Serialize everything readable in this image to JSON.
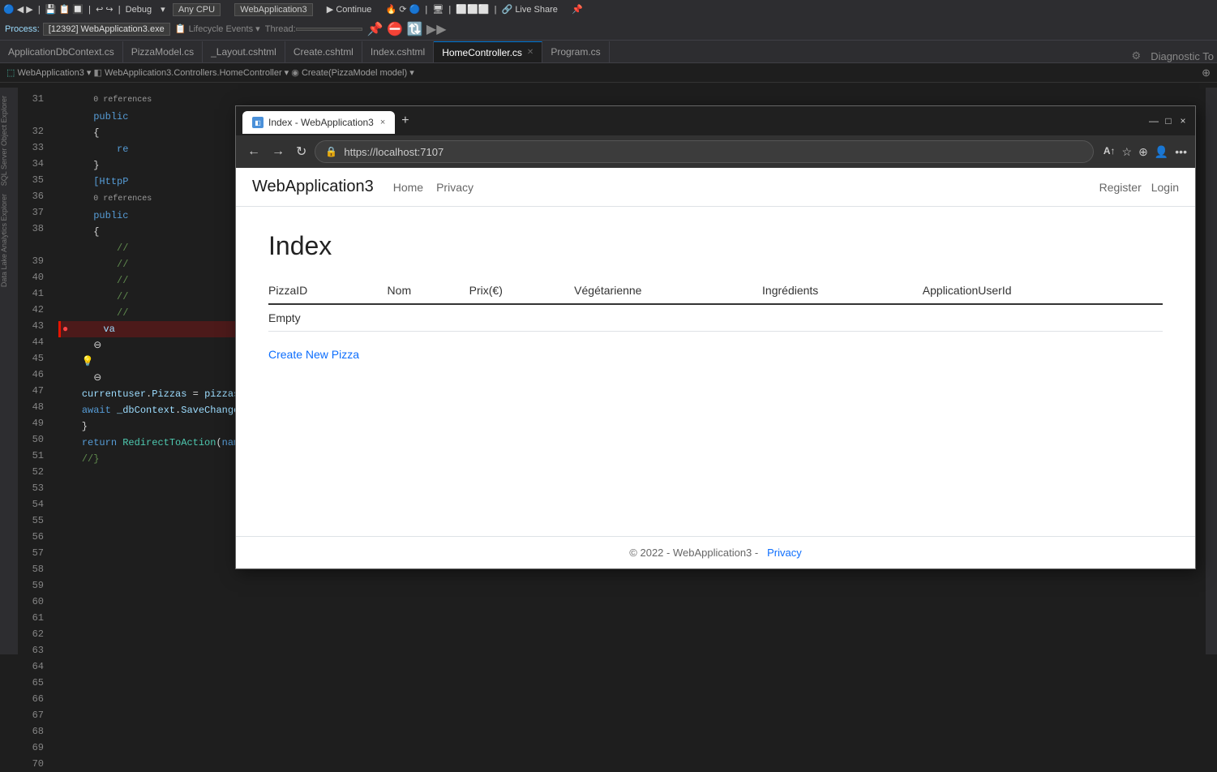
{
  "ide": {
    "top_bar": {
      "items": [
        "CPU"
      ]
    },
    "toolbar": {
      "process_label": "Process:",
      "process_value": "[12392] WebApplication3.exe",
      "debug_label": "Debug",
      "cpu_label": "Any CPU",
      "app_label": "WebApplication3",
      "continue_label": "Continue",
      "live_share_label": "Live Share"
    },
    "lifecycle_events": "Lifecycle Events",
    "thread_label": "Thread:",
    "tabs": [
      {
        "label": "ApplicationDbContext.cs",
        "active": false,
        "close": false
      },
      {
        "label": "PizzaModel.cs",
        "active": false,
        "close": false
      },
      {
        "label": "_Layout.cshtml",
        "active": false,
        "close": false
      },
      {
        "label": "Create.cshtml",
        "active": false,
        "close": false
      },
      {
        "label": "Index.cshtml",
        "active": false,
        "close": false
      },
      {
        "label": "HomeController.cs",
        "active": true,
        "close": true
      },
      {
        "label": "Program.cs",
        "active": false,
        "close": false
      }
    ],
    "breadcrumb": {
      "project": "WebApplication3",
      "class": "WebApplication3.Controllers.HomeController",
      "method": "Create(PizzaModel model)"
    },
    "line_numbers": [
      31,
      32,
      33,
      34,
      35,
      36,
      37,
      38,
      39,
      40,
      41,
      42,
      43,
      44,
      45,
      46,
      47,
      48,
      49,
      50,
      51,
      52,
      53,
      54,
      55,
      56,
      57,
      58,
      59,
      60,
      61,
      62,
      63,
      64,
      65,
      66,
      67,
      68,
      69,
      70
    ],
    "code_lines": [
      "        public",
      "        {",
      "            re",
      "        }",
      "",
      "",
      "        [HttpP",
      "        0 references",
      "        public",
      "",
      "            //",
      "            //",
      "            //",
      "            //",
      "            //",
      "            //",
      "            va",
      "",
      "",
      "        ⚡",
      "",
      "",
      "",
      "",
      "",
      "",
      "",
      "",
      "",
      "",
      "",
      "",
      "",
      "            currentuser.Pizzas = pizzas;",
      "            await _dbContext.SaveChangesAsync();",
      "        }",
      "",
      "        return RedirectToAction(nameof(Index));",
      "        //}",
      ""
    ],
    "sidebar_labels": [
      "SQL Server Object Explorer",
      "Data Lake Analytics Explorer"
    ]
  },
  "browser": {
    "title": "Index - WebApplication3",
    "tab_icon": "◧",
    "close_button": "×",
    "new_tab_button": "+",
    "window_controls": {
      "minimize": "—",
      "maximize": "□",
      "close": "×"
    },
    "nav": {
      "back_disabled": false,
      "forward_disabled": false,
      "refresh": "↻",
      "url": "https://localhost:7107",
      "read_aloud": "A↑",
      "favorites": "☆",
      "star": "⭐",
      "collections": "⊕",
      "profile": "👤",
      "more": "•••"
    },
    "page": {
      "brand": "WebApplication3",
      "nav_links": [
        "Home",
        "Privacy"
      ],
      "auth_links": [
        "Register",
        "Login"
      ],
      "heading": "Index",
      "table": {
        "columns": [
          "PizzaID",
          "Nom",
          "Prix(€)",
          "Végétarienne",
          "Ingrédients",
          "ApplicationUserId"
        ],
        "rows": [],
        "empty_message": "Empty"
      },
      "create_link": "Create New Pizza",
      "footer": {
        "text": "© 2022 - WebApplication3 -",
        "privacy_link": "Privacy"
      }
    }
  }
}
